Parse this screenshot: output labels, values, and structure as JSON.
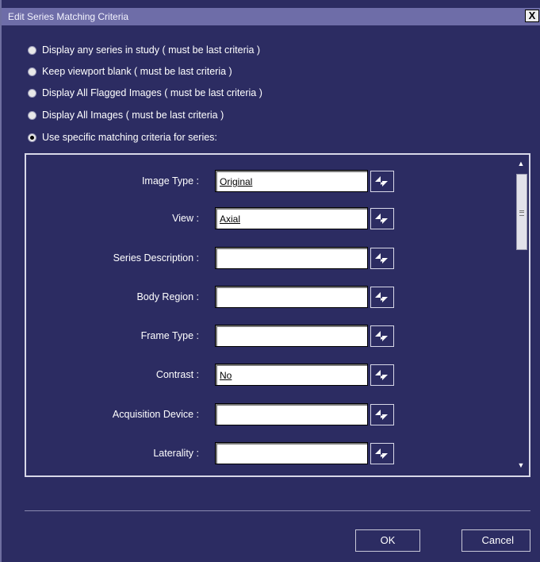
{
  "window": {
    "title": "Edit Series Matching Criteria",
    "close_symbol": "X"
  },
  "options": [
    {
      "label": "Display any series in study ( must be last criteria )",
      "checked": false
    },
    {
      "label": "Keep viewport blank ( must be last criteria )",
      "checked": false
    },
    {
      "label": "Display All Flagged Images ( must be last criteria )",
      "checked": false
    },
    {
      "label": "Display All Images ( must be last criteria )",
      "checked": false
    },
    {
      "label": "Use specific matching criteria for series:",
      "checked": true
    }
  ],
  "fields": [
    {
      "label": "Image Type :",
      "value": "Original"
    },
    {
      "label": "View :",
      "value": "Axial"
    },
    {
      "label": "Series Description :",
      "value": ""
    },
    {
      "label": "Body Region :",
      "value": ""
    },
    {
      "label": "Frame Type :",
      "value": ""
    },
    {
      "label": "Contrast :",
      "value": "No"
    },
    {
      "label": "Acquisition Device :",
      "value": ""
    },
    {
      "label": "Laterality :",
      "value": ""
    }
  ],
  "buttons": {
    "ok": "OK",
    "cancel": "Cancel"
  },
  "colors": {
    "background": "#2c2c62",
    "titlebar": "#6e6da8"
  }
}
